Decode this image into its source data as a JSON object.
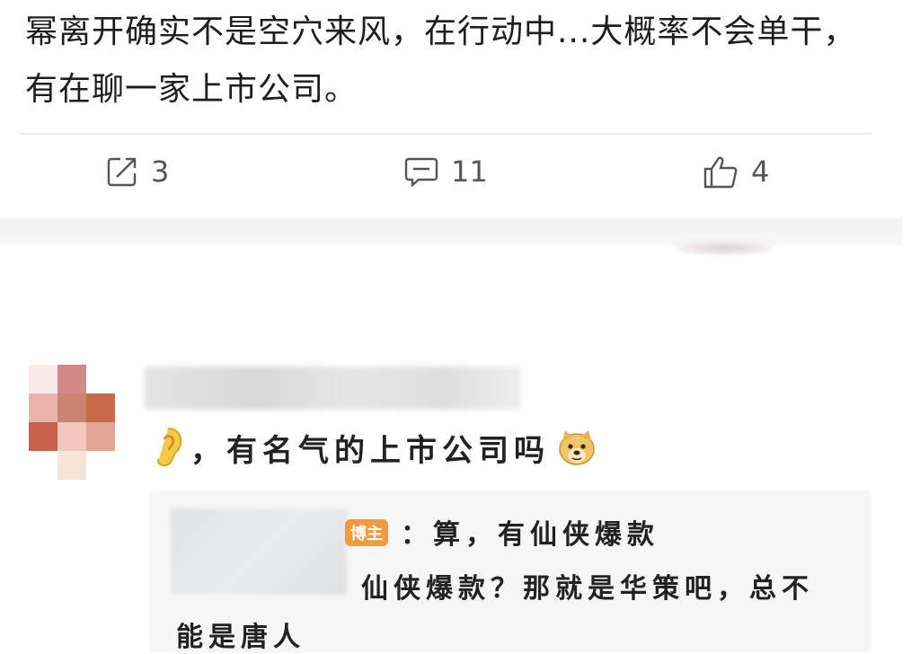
{
  "post": {
    "text": "幂离开确实不是空穴来风，在行动中...大概率不会单干，有在聊一家上市公司。"
  },
  "actions": {
    "repost_count": "3",
    "comment_count": "11",
    "like_count": "4"
  },
  "comment": {
    "text": "，有名气的上市公司吗"
  },
  "reply": {
    "badge": "博主",
    "line1": "：算，有仙侠爆款",
    "line2": "仙侠爆款？那就是华策吧，总不",
    "line3": "能是唐人"
  },
  "colors": {
    "badge": "#f39b3a",
    "icon": "#555555"
  }
}
